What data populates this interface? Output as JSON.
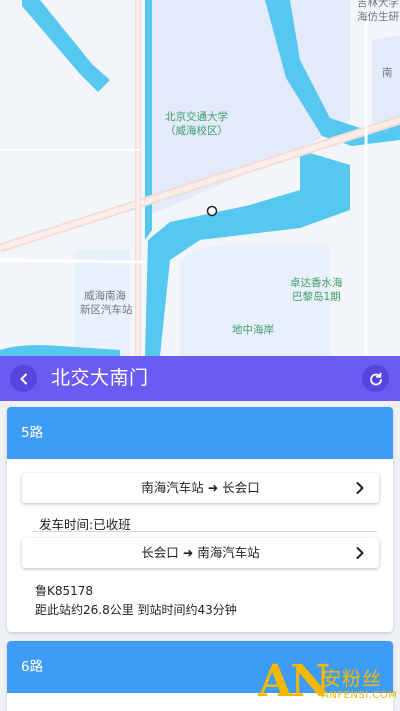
{
  "map": {
    "labels": {
      "campus": "北京交通大学",
      "campus_sub": "（威海校区）",
      "top_right_1": "吉林大学",
      "top_right_2": "海仿生研",
      "right_edge": "南",
      "bus_station_1": "威海南海",
      "bus_station_2": "新区汽车站",
      "estate_1": "卓达香水海",
      "estate_2": "巴黎岛1期",
      "coast": "地中海岸"
    },
    "colors": {
      "water": "#56c8f0",
      "campus": "#e3ebfb",
      "land": "#f2f5fa",
      "road": "#f3dcd6"
    }
  },
  "header": {
    "title": "北交大南门",
    "back_icon": "chevron-left-icon",
    "refresh_icon": "refresh-icon",
    "color": "#6a5cf2"
  },
  "routes": [
    {
      "name": "5路",
      "directions": [
        {
          "label": "南海汽车站 ➜ 长会口"
        },
        {
          "label": "长会口 ➜ 南海汽车站"
        }
      ],
      "depart_time": "发车时间:已收班",
      "plate": "鲁K85178",
      "distance": "距此站约26.8公里 到站时间约43分钟"
    },
    {
      "name": "6路"
    }
  ],
  "watermark": {
    "logo": "AN",
    "cn": "安粉丝",
    "en": "ANFENSI.COM"
  },
  "accent": "#3f9cf5"
}
